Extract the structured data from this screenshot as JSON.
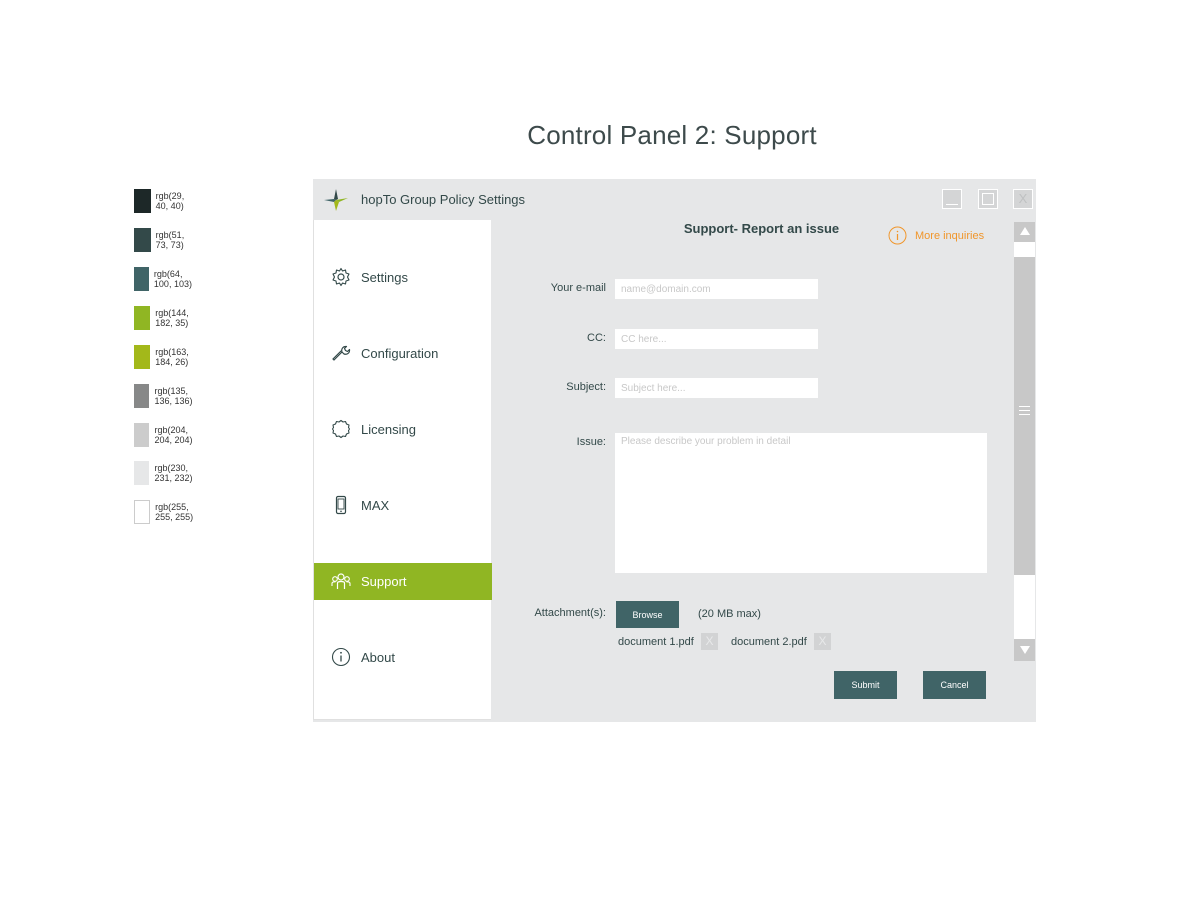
{
  "page_title": "Control Panel 2: Support",
  "swatches": [
    {
      "label": "rgb(29, 40, 40)",
      "color": "#1d2828"
    },
    {
      "label": "rgb(51, 73, 73)",
      "color": "#334949"
    },
    {
      "label": "rgb(64, 100, 103)",
      "color": "#406467"
    },
    {
      "label": "rgb(144, 182, 35)",
      "color": "#90b623"
    },
    {
      "label": "rgb(163, 184, 26)",
      "color": "#a3b81a"
    },
    {
      "label": "rgb(135, 136, 136)",
      "color": "#878888"
    },
    {
      "label": "rgb(204, 204, 204)",
      "color": "#cccccc"
    },
    {
      "label": "rgb(230, 231, 232)",
      "color": "#e6e7e8"
    },
    {
      "label": "rgb(255, 255, 255)",
      "color": "#ffffff"
    }
  ],
  "window": {
    "title": "hopTo Group Policy Settings",
    "close_label": "X"
  },
  "sidebar": {
    "items": [
      {
        "label": "Settings",
        "icon": "gear-icon",
        "active": false
      },
      {
        "label": "Configuration",
        "icon": "wrench-icon",
        "active": false
      },
      {
        "label": "Licensing",
        "icon": "badge-icon",
        "active": false
      },
      {
        "label": "MAX",
        "icon": "phone-icon",
        "active": false
      },
      {
        "label": "Support",
        "icon": "people-icon",
        "active": true
      },
      {
        "label": "About",
        "icon": "info-icon",
        "active": false
      }
    ]
  },
  "support": {
    "title": "Support- Report an issue",
    "more_inquiries": "More inquiries",
    "email_label": "Your e-mail",
    "email_placeholder": "name@domain.com",
    "cc_label": "CC:",
    "cc_placeholder": "CC here...",
    "subject_label": "Subject:",
    "subject_placeholder": "Subject here...",
    "issue_label": "Issue:",
    "issue_placeholder": "Please describe your problem in detail",
    "attachments_label": "Attachment(s):",
    "browse_label": "Browse",
    "max_note": "(20 MB max)",
    "attachments": [
      {
        "name": "document 1.pdf",
        "remove_label": "X"
      },
      {
        "name": "document 2.pdf",
        "remove_label": "X"
      }
    ],
    "submit_label": "Submit",
    "cancel_label": "Cancel"
  },
  "colors": {
    "accent": "#90b623",
    "button": "#406467",
    "text": "#334949",
    "orange": "#f0962b"
  }
}
